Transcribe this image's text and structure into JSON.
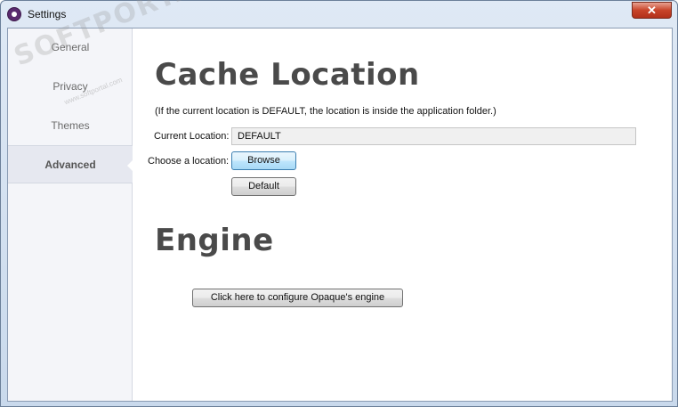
{
  "window": {
    "title": "Settings",
    "close_glyph": "✕"
  },
  "sidebar": {
    "items": [
      {
        "label": "General"
      },
      {
        "label": "Privacy"
      },
      {
        "label": "Themes"
      },
      {
        "label": "Advanced",
        "active": true
      }
    ]
  },
  "cache": {
    "heading": "Cache Location",
    "note": "(If the current location is DEFAULT, the location is inside the application folder.)",
    "current_label": "Current Location:",
    "current_value": "DEFAULT",
    "choose_label": "Choose a location:",
    "browse_button": "Browse",
    "default_button": "Default"
  },
  "engine": {
    "heading": "Engine",
    "configure_button": "Click here to configure Opaque's engine"
  },
  "watermark": {
    "text": "SOFTPORTAL",
    "url": "www.softportal.com"
  },
  "colors": {
    "accent_purple": "#5a2a6e",
    "close_red": "#c8442a",
    "heading_gray": "#4a4a4a"
  }
}
